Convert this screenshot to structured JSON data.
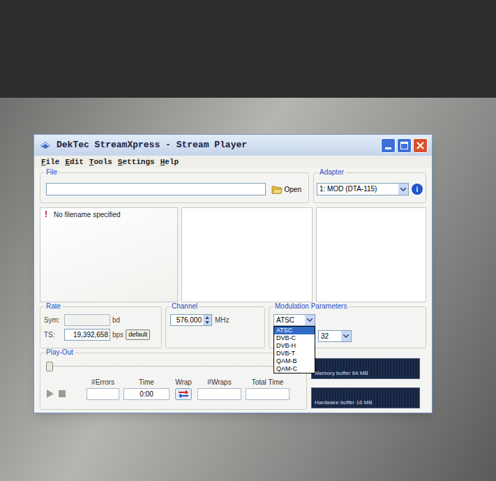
{
  "window": {
    "title": "DekTec StreamXpress - Stream Player"
  },
  "menu": [
    "File",
    "Edit",
    "Tools",
    "Settings",
    "Help"
  ],
  "file": {
    "label": "File",
    "path": "",
    "open_button": "Open"
  },
  "adapter": {
    "label": "Adapter",
    "value": "1: MOD (DTA-115)",
    "info_icon": "i"
  },
  "status_panel": {
    "icon": "!",
    "message": "No filename specified"
  },
  "rate": {
    "label": "Rate",
    "sym_label": "Sym:",
    "sym_value": "",
    "sym_unit": "bd",
    "ts_label": "TS:",
    "ts_value": "19,392,658",
    "ts_unit": "bps",
    "default_button": "default"
  },
  "channel": {
    "label": "Channel",
    "value": "576.000",
    "unit": "MHz"
  },
  "modulation": {
    "label": "Modulation Parameters",
    "value": "ATSC",
    "expanded": true,
    "options": [
      {
        "label": "ATSC",
        "selected": true
      },
      {
        "label": "DVB-C",
        "selected": false
      },
      {
        "label": "DVB-H",
        "selected": false
      },
      {
        "label": "DVB-T",
        "selected": false
      },
      {
        "label": "QAM-B",
        "selected": false
      },
      {
        "label": "QAM-C",
        "selected": false
      }
    ],
    "second_value": "32"
  },
  "playout": {
    "label": "Play-Out",
    "level": 0,
    "fields": [
      {
        "label": "#Errors",
        "value": "",
        "kind": "field"
      },
      {
        "label": "Time",
        "value": "0:00",
        "kind": "field"
      },
      {
        "label": "Wrap",
        "kind": "toggle"
      },
      {
        "label": "#Wraps",
        "value": "",
        "kind": "field"
      },
      {
        "label": "Total Time",
        "value": "",
        "kind": "field"
      }
    ]
  },
  "buffers": [
    {
      "label": "Memory buffer 64 MB"
    },
    {
      "label": "Hardware buffer 16 MB"
    }
  ]
}
